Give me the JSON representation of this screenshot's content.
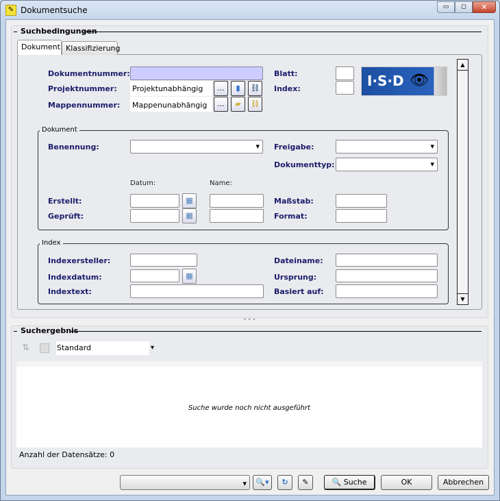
{
  "window": {
    "title": "Dokumentsuche"
  },
  "search_conditions": {
    "title": "Suchbedingungen",
    "tabs": [
      "Dokument",
      "Klassifizierung"
    ],
    "dokumentnummer_label": "Dokumentnummer:",
    "dokumentnummer_value": "",
    "projektnummer_label": "Projektnummer:",
    "projektnummer_value": "Projektunabhängig",
    "mappennummer_label": "Mappennummer:",
    "mappennummer_value": "Mappenunabhängig",
    "browse_label": "...",
    "blatt_label": "Blatt:",
    "index_label": "Index:",
    "logo_text": "I·S·D",
    "dokument_group": {
      "title": "Dokument",
      "benennung": "Benennung:",
      "freigabe": "Freigabe:",
      "dokumenttyp": "Dokumenttyp:",
      "datum": "Datum:",
      "name": "Name:",
      "erstellt": "Erstellt:",
      "geprueft": "Geprüft:",
      "massstab": "Maßstab:",
      "format": "Format:"
    },
    "index_group": {
      "title": "Index",
      "indexersteller": "Indexersteller:",
      "indexdatum": "Indexdatum:",
      "indextext": "Indextext:",
      "dateiname": "Dateiname:",
      "ursprung": "Ursprung:",
      "basiert_auf": "Basiert auf:"
    }
  },
  "results": {
    "title": "Suchergebnis",
    "view": "Standard",
    "empty_message": "Suche wurde noch nicht ausgeführt",
    "count_label": "Anzahl der Datensätze: 0"
  },
  "footer": {
    "search": "Suche",
    "ok": "OK",
    "cancel": "Abbrechen"
  }
}
